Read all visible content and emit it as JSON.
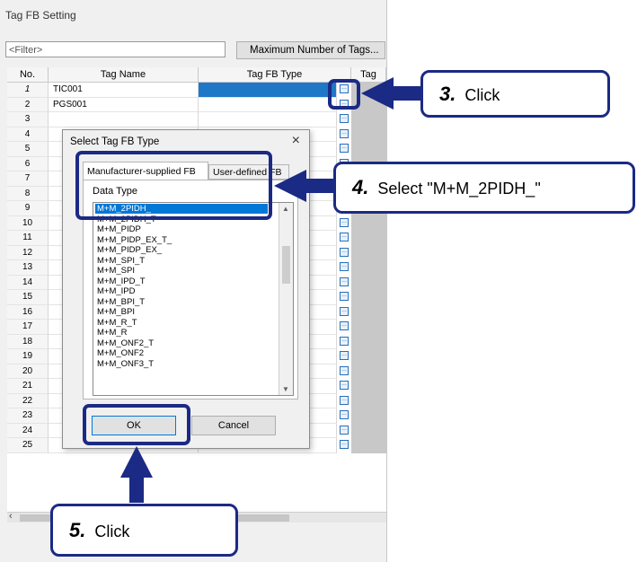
{
  "window": {
    "title": "Tag FB Setting"
  },
  "toolbar": {
    "filter_placeholder": "<Filter>",
    "max_tags_label": "Maximum Number of Tags..."
  },
  "grid": {
    "columns": [
      "No.",
      "Tag Name",
      "Tag FB Type",
      "Tag"
    ],
    "rows": [
      {
        "no": "1",
        "name": "TIC001"
      },
      {
        "no": "2",
        "name": "PGS001"
      },
      {
        "no": "3",
        "name": ""
      },
      {
        "no": "4",
        "name": ""
      },
      {
        "no": "5",
        "name": ""
      },
      {
        "no": "6",
        "name": ""
      },
      {
        "no": "7",
        "name": ""
      },
      {
        "no": "8",
        "name": ""
      },
      {
        "no": "9",
        "name": ""
      },
      {
        "no": "10",
        "name": ""
      },
      {
        "no": "11",
        "name": ""
      },
      {
        "no": "12",
        "name": ""
      },
      {
        "no": "13",
        "name": ""
      },
      {
        "no": "14",
        "name": ""
      },
      {
        "no": "15",
        "name": ""
      },
      {
        "no": "16",
        "name": ""
      },
      {
        "no": "17",
        "name": ""
      },
      {
        "no": "18",
        "name": ""
      },
      {
        "no": "19",
        "name": ""
      },
      {
        "no": "20",
        "name": ""
      },
      {
        "no": "21",
        "name": ""
      },
      {
        "no": "22",
        "name": ""
      },
      {
        "no": "23",
        "name": ""
      },
      {
        "no": "24",
        "name": ""
      },
      {
        "no": "25",
        "name": ""
      }
    ],
    "ellipsis": "..."
  },
  "dialog": {
    "title": "Select Tag FB Type",
    "close": "×",
    "tabs": [
      "Manufacturer-supplied FB",
      "User-defined FB"
    ],
    "data_type_label": "Data Type",
    "items": [
      "M+M_2PIDH_",
      "M+M_2PIDH_T",
      "M+M_PIDP",
      "M+M_PIDP_EX_T_",
      "M+M_PIDP_EX_",
      "M+M_SPI_T",
      "M+M_SPI",
      "M+M_IPD_T",
      "M+M_IPD",
      "M+M_BPI_T",
      "M+M_BPI",
      "M+M_R_T",
      "M+M_R",
      "M+M_ONF2_T",
      "M+M_ONF2",
      "M+M_ONF3_T"
    ],
    "selected_index": 0,
    "ok_label": "OK",
    "cancel_label": "Cancel"
  },
  "callouts": {
    "step3": {
      "num": "3.",
      "text": "Click"
    },
    "step4": {
      "num": "4.",
      "text": "Select \"M+M_2PIDH_\""
    },
    "step5": {
      "num": "5.",
      "text": "Click"
    }
  },
  "colors": {
    "accent": "#1b2a84",
    "selection": "#1f77c8"
  }
}
